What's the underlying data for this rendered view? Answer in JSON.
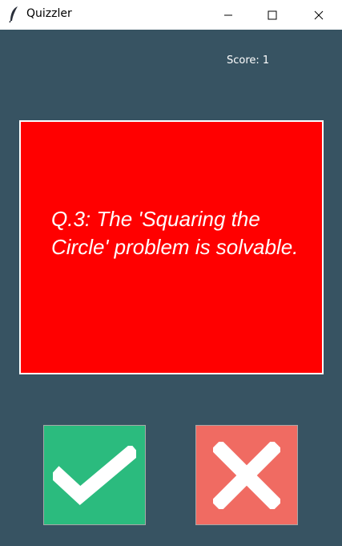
{
  "window": {
    "title": "Quizzler"
  },
  "score": {
    "text": "Score: 1"
  },
  "question": {
    "text": "Q.3: The 'Squaring the Circle' problem is solvable."
  },
  "colors": {
    "background": "#375362",
    "card": "#ff0000",
    "true_button": "#2bbb7e",
    "false_button": "#f06b62"
  },
  "buttons": {
    "true_icon": "check-icon",
    "false_icon": "cross-icon"
  }
}
